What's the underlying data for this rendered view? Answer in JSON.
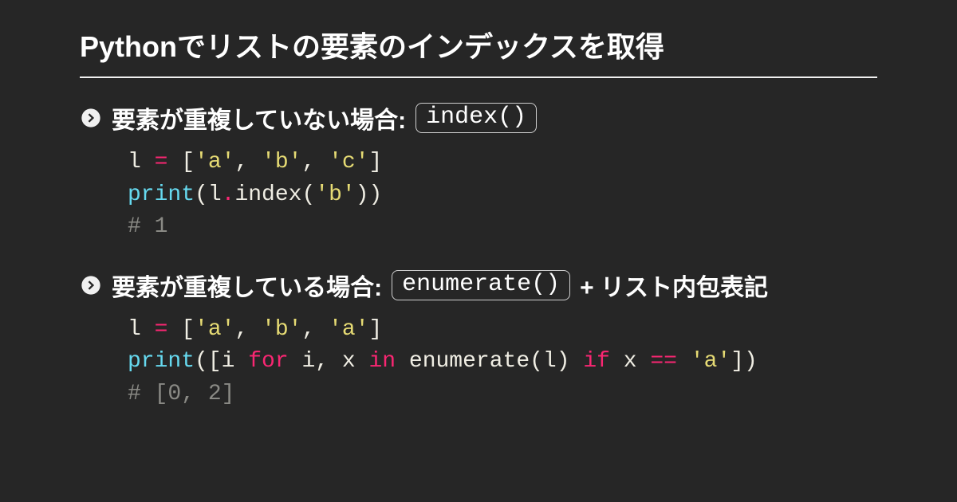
{
  "title": "Pythonでリストの要素のインデックスを取得",
  "sections": [
    {
      "heading_prefix": "要素が重複していない場合: ",
      "heading_code": "index()",
      "heading_suffix": "",
      "code": {
        "l1_var": "l ",
        "l1_eq": "=",
        "l1_open": " [",
        "l1_s1": "'a'",
        "l1_c1": ", ",
        "l1_s2": "'b'",
        "l1_c2": ", ",
        "l1_s3": "'c'",
        "l1_close": "]",
        "l2_print": "print",
        "l2_open": "(l",
        "l2_dot": ".",
        "l2_method": "index(",
        "l2_arg": "'b'",
        "l2_close": "))",
        "l3_comment": "# 1"
      }
    },
    {
      "heading_prefix": "要素が重複している場合: ",
      "heading_code": "enumerate()",
      "heading_suffix": " + リスト内包表記",
      "code": {
        "l1_var": "l ",
        "l1_eq": "=",
        "l1_open": " [",
        "l1_s1": "'a'",
        "l1_c1": ", ",
        "l1_s2": "'b'",
        "l1_c2": ", ",
        "l1_s3": "'a'",
        "l1_close": "]",
        "l2_print": "print",
        "l2_a": "([i ",
        "l2_for": "for",
        "l2_b": " i, x ",
        "l2_in": "in",
        "l2_c": " enumerate(l) ",
        "l2_if": "if",
        "l2_d": " x ",
        "l2_eqeq": "==",
        "l2_e": " ",
        "l2_str": "'a'",
        "l2_close": "])",
        "l3_comment": "# [0, 2]"
      }
    }
  ]
}
